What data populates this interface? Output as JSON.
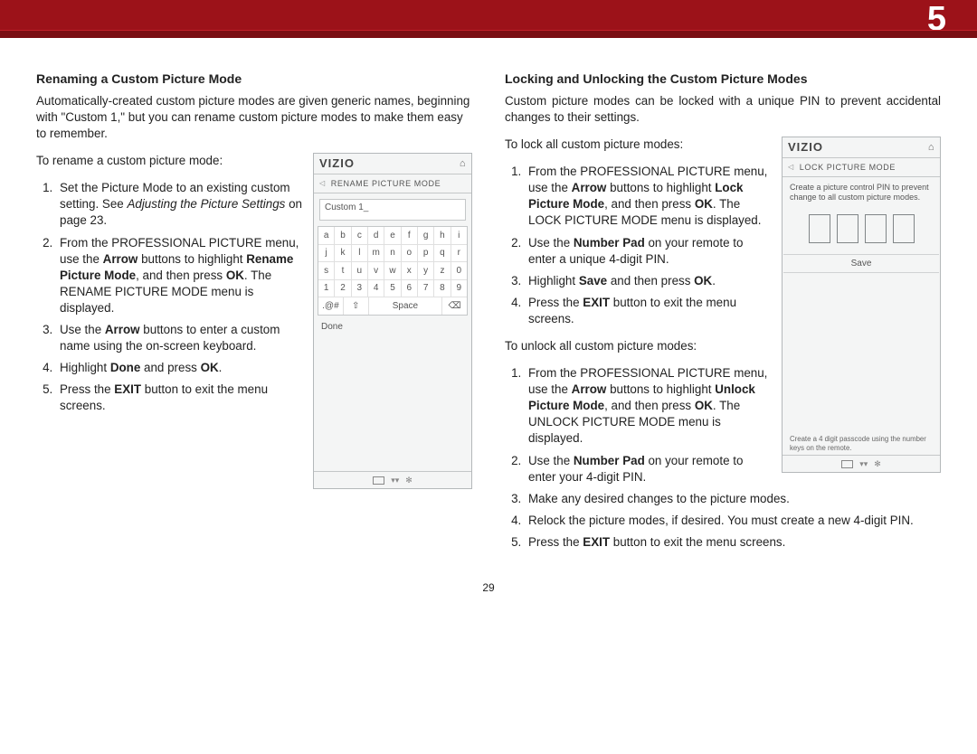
{
  "chapter_num": "5",
  "page_number": "29",
  "left": {
    "heading": "Renaming a Custom Picture Mode",
    "intro": "Automatically-created custom picture modes are given generic names, beginning with \"Custom 1,\" but you can rename custom picture modes to make them easy to remember.",
    "lead": "To rename a custom picture mode:",
    "s1a": "Set the Picture Mode to an existing custom setting. See ",
    "s1b": "Adjusting the Picture Settings",
    "s1c": " on page 23.",
    "s2a": "From the PROFESSIONAL PICTURE menu, use the ",
    "s2b": "Arrow",
    "s2c": " buttons to highlight ",
    "s2d": "Rename Picture Mode",
    "s2e": ", and then press ",
    "s2f": "OK",
    "s2g": ". The RENAME PICTURE MODE menu is displayed.",
    "s3a": "Use the ",
    "s3b": "Arrow",
    "s3c": " buttons to enter a custom name using the on-screen keyboard.",
    "s4a": "Highlight ",
    "s4b": "Done",
    "s4c": " and press ",
    "s4d": "OK",
    "s4e": ".",
    "s5a": "Press the ",
    "s5b": "EXIT",
    "s5c": " button to exit the menu screens."
  },
  "right": {
    "heading": "Locking and Unlocking the Custom Picture Modes",
    "intro": "Custom picture modes can be locked with a unique PIN to prevent accidental changes to their settings.",
    "lead_lock": "To lock all custom picture modes:",
    "l1a": "From the PROFESSIONAL PICTURE menu, use the ",
    "l1b": "Arrow",
    "l1c": " buttons to highlight ",
    "l1d": "Lock Picture Mode",
    "l1e": ", and then press ",
    "l1f": "OK",
    "l1g": ". The LOCK PICTURE MODE menu is displayed.",
    "l2a": "Use the ",
    "l2b": "Number Pad",
    "l2c": " on your remote to enter a unique 4-digit PIN.",
    "l3a": "Highlight ",
    "l3b": "Save",
    "l3c": " and then press ",
    "l3d": "OK",
    "l3e": ".",
    "l4a": "Press the ",
    "l4b": "EXIT",
    "l4c": " button to exit the menu screens.",
    "lead_unlock": "To unlock all custom picture modes:",
    "u1a": "From the PROFESSIONAL PICTURE menu, use the ",
    "u1b": "Arrow",
    "u1c": " buttons to highlight ",
    "u1d": "Unlock Picture Mode",
    "u1e": ", and then press ",
    "u1f": "OK",
    "u1g": ". The UNLOCK PICTURE MODE menu is displayed.",
    "u2a": "Use the ",
    "u2b": "Number Pad",
    "u2c": " on your remote to enter your 4-digit PIN.",
    "u3": "Make any desired changes to the picture modes.",
    "u4": "Relock the picture modes, if desired. You must create a new 4-digit PIN.",
    "u5a": "Press the ",
    "u5b": "EXIT",
    "u5c": " button to exit the menu screens."
  },
  "device1": {
    "logo": "VIZIO",
    "title": "RENAME PICTURE MODE",
    "input": "Custom 1_",
    "row1": [
      "a",
      "b",
      "c",
      "d",
      "e",
      "f",
      "g",
      "h",
      "i"
    ],
    "row2": [
      "j",
      "k",
      "l",
      "m",
      "n",
      "o",
      "p",
      "q",
      "r"
    ],
    "row3": [
      "s",
      "t",
      "u",
      "v",
      "w",
      "x",
      "y",
      "z",
      "0"
    ],
    "row4": [
      "1",
      "2",
      "3",
      "4",
      "5",
      "6",
      "7",
      "8",
      "9"
    ],
    "row5": [
      ".@#",
      "⇧",
      "Space",
      "⌫"
    ],
    "done": "Done"
  },
  "device2": {
    "logo": "VIZIO",
    "title": "LOCK PICTURE MODE",
    "msg": "Create a picture control PIN to prevent change to all custom picture modes.",
    "save": "Save",
    "note": "Create a 4 digit passcode using the number keys on the remote."
  },
  "icons": {
    "home": "⌂",
    "back_tri": "◁",
    "gear": "✻"
  }
}
